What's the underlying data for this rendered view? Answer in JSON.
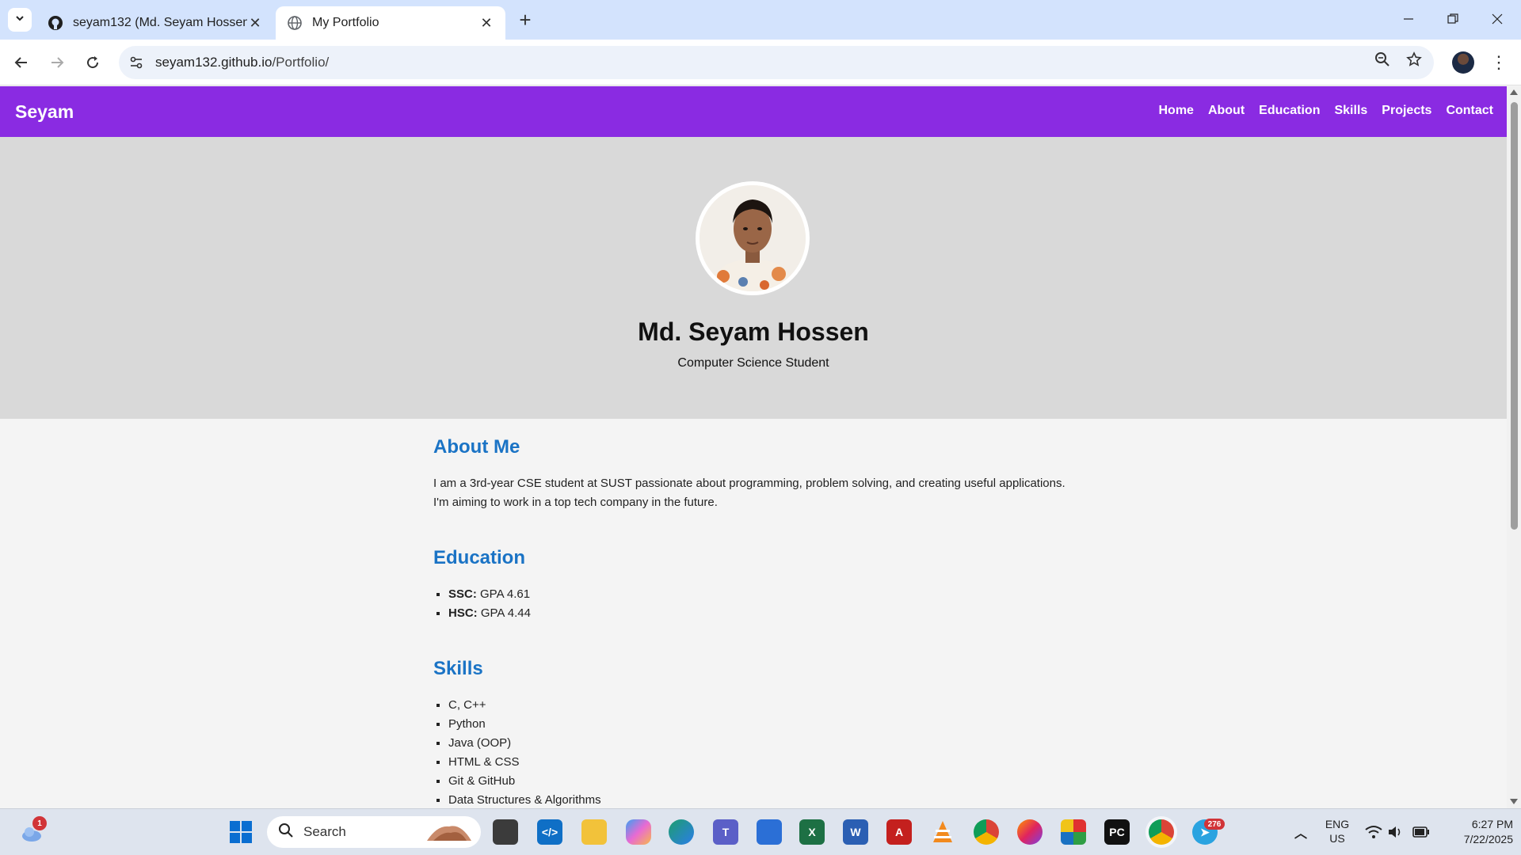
{
  "browser": {
    "tabs": [
      {
        "title": "seyam132 (Md. Seyam Hossen)",
        "favicon": "github-icon"
      },
      {
        "title": "My Portfolio",
        "favicon": "globe-icon",
        "active": true
      }
    ],
    "url_host": "seyam132.github.io",
    "url_path": "/Portfolio/"
  },
  "site": {
    "brand": "Seyam",
    "nav": [
      "Home",
      "About",
      "Education",
      "Skills",
      "Projects",
      "Contact"
    ],
    "colors": {
      "nav": "#8a2be2",
      "heading": "#1a73c5",
      "hero": "#d9d9d9"
    }
  },
  "hero": {
    "name": "Md. Seyam Hossen",
    "subtitle": "Computer Science Student"
  },
  "about": {
    "heading": "About Me",
    "line1": "I am a 3rd-year CSE student at SUST passionate about programming, problem solving, and creating useful applications.",
    "line2": "I'm aiming to work in a top tech company in the future."
  },
  "education": {
    "heading": "Education",
    "items": [
      {
        "label": "SSC:",
        "value": "GPA 4.61"
      },
      {
        "label": "HSC:",
        "value": "GPA 4.44"
      }
    ]
  },
  "skills": {
    "heading": "Skills",
    "items": [
      "C, C++",
      "Python",
      "Java (OOP)",
      "HTML & CSS",
      "Git & GitHub",
      "Data Structures & Algorithms"
    ]
  },
  "taskbar": {
    "weather_badge": "1",
    "search_placeholder": "Search",
    "telegram_badge": "276",
    "lang": "ENG",
    "region": "US",
    "time": "6:27 PM",
    "date": "7/22/2025"
  }
}
